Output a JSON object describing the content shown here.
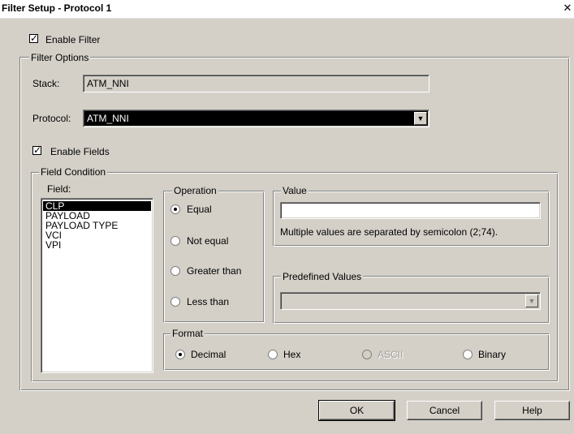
{
  "window": {
    "title": "Filter Setup - Protocol 1",
    "close_glyph": "✕"
  },
  "enable_filter": {
    "label": "Enable Filter",
    "checked": true
  },
  "filter_options": {
    "legend": "Filter Options",
    "stack": {
      "label": "Stack:",
      "value": "ATM_NNI"
    },
    "protocol": {
      "label": "Protocol:",
      "value": "ATM_NNI",
      "arrow": "▼"
    }
  },
  "enable_fields": {
    "label": "Enable Fields",
    "checked": true
  },
  "field_condition": {
    "legend": "Field Condition",
    "field_label": "Field:",
    "fields": [
      "CLP",
      "PAYLOAD",
      "PAYLOAD TYPE",
      "VCI",
      "VPI"
    ],
    "selected_field": "CLP",
    "operation": {
      "legend": "Operation",
      "options": [
        "Equal",
        "Not equal",
        "Greater than",
        "Less than"
      ],
      "selected": "Equal"
    },
    "value": {
      "legend": "Value",
      "input_value": "",
      "hint": "Multiple values are separated by semicolon (2;74)."
    },
    "predefined_values": {
      "legend": "Predefined Values",
      "value": "",
      "arrow": "▼"
    },
    "format": {
      "legend": "Format",
      "options": [
        "Decimal",
        "Hex",
        "ASCII",
        "Binary"
      ],
      "selected": "Decimal",
      "disabled": "ASCII"
    }
  },
  "buttons": {
    "ok": "OK",
    "cancel": "Cancel",
    "help": "Help"
  },
  "colors": {
    "dialog_bg": "#d4d0c8",
    "selection": "#000000",
    "title_bg": "#ffffff"
  }
}
